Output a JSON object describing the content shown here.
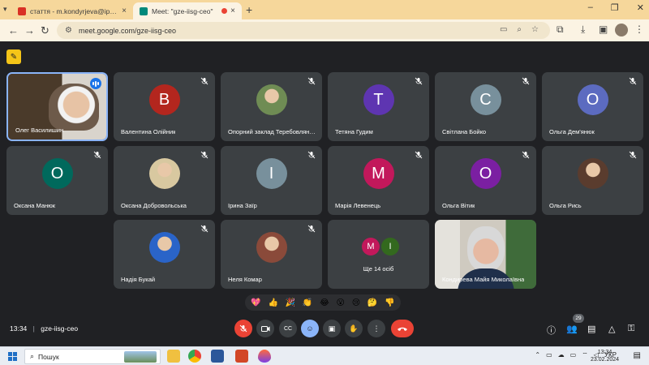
{
  "browser": {
    "tabs": [
      {
        "title": "стаття - m.kondyrjeva@ippo.edu",
        "active": false
      },
      {
        "title": "Meet: \"gze-iisg-ceo\"",
        "active": true
      }
    ],
    "url": "meet.google.com/gze-iisg-ceo"
  },
  "meet": {
    "tiles": [
      {
        "name": "Олег Василишин",
        "kind": "video",
        "speaking": true
      },
      {
        "name": "Валентина Олійник",
        "kind": "initial",
        "initial": "В",
        "color": "#b3261e"
      },
      {
        "name": "Опорний заклад Теребовлянс...",
        "kind": "photo",
        "color": "#6f8c54"
      },
      {
        "name": "Тетяна Гудим",
        "kind": "initial",
        "initial": "Т",
        "color": "#5e35b1"
      },
      {
        "name": "Світлана Бойко",
        "kind": "initial",
        "initial": "С",
        "color": "#78909c"
      },
      {
        "name": "Ольга Дем'янюк",
        "kind": "initial",
        "initial": "О",
        "color": "#5c6bc0"
      },
      {
        "name": "Оксана Манюк",
        "kind": "initial",
        "initial": "О",
        "color": "#00695c"
      },
      {
        "name": "Оксана Добровольська",
        "kind": "photo",
        "color": "#d8c8a0"
      },
      {
        "name": "Ірина Заїр",
        "kind": "initial",
        "initial": "І",
        "color": "#78909c"
      },
      {
        "name": "Марія Левенець",
        "kind": "initial",
        "initial": "М",
        "color": "#c2185b"
      },
      {
        "name": "Ольга Вітик",
        "kind": "initial",
        "initial": "О",
        "color": "#7b1fa2"
      },
      {
        "name": "Ольга Рись",
        "kind": "photo",
        "color": "#5a3c2e"
      },
      {
        "name": "Надія Букай",
        "kind": "photo",
        "color": "#2a64c8"
      },
      {
        "name": "Неля Комар",
        "kind": "photo",
        "color": "#8a4a3a"
      },
      {
        "name": "Ще 14 осіб",
        "kind": "more",
        "initials": [
          "М",
          "І"
        ],
        "colors": [
          "#c2185b",
          "#33691e"
        ]
      },
      {
        "name": "Кондирева Майя Миколаївна",
        "kind": "video-self"
      }
    ],
    "reactions": [
      "💖",
      "👍",
      "🎉",
      "👏",
      "😂",
      "😮",
      "😢",
      "🤔",
      "👎"
    ],
    "clock": "13:34",
    "meeting_code": "gze-iisg-ceo",
    "participants_count": "29"
  },
  "taskbar": {
    "search_placeholder": "Пошук",
    "lang": "УКР",
    "time": "13:34",
    "date": "23.02.2024"
  }
}
